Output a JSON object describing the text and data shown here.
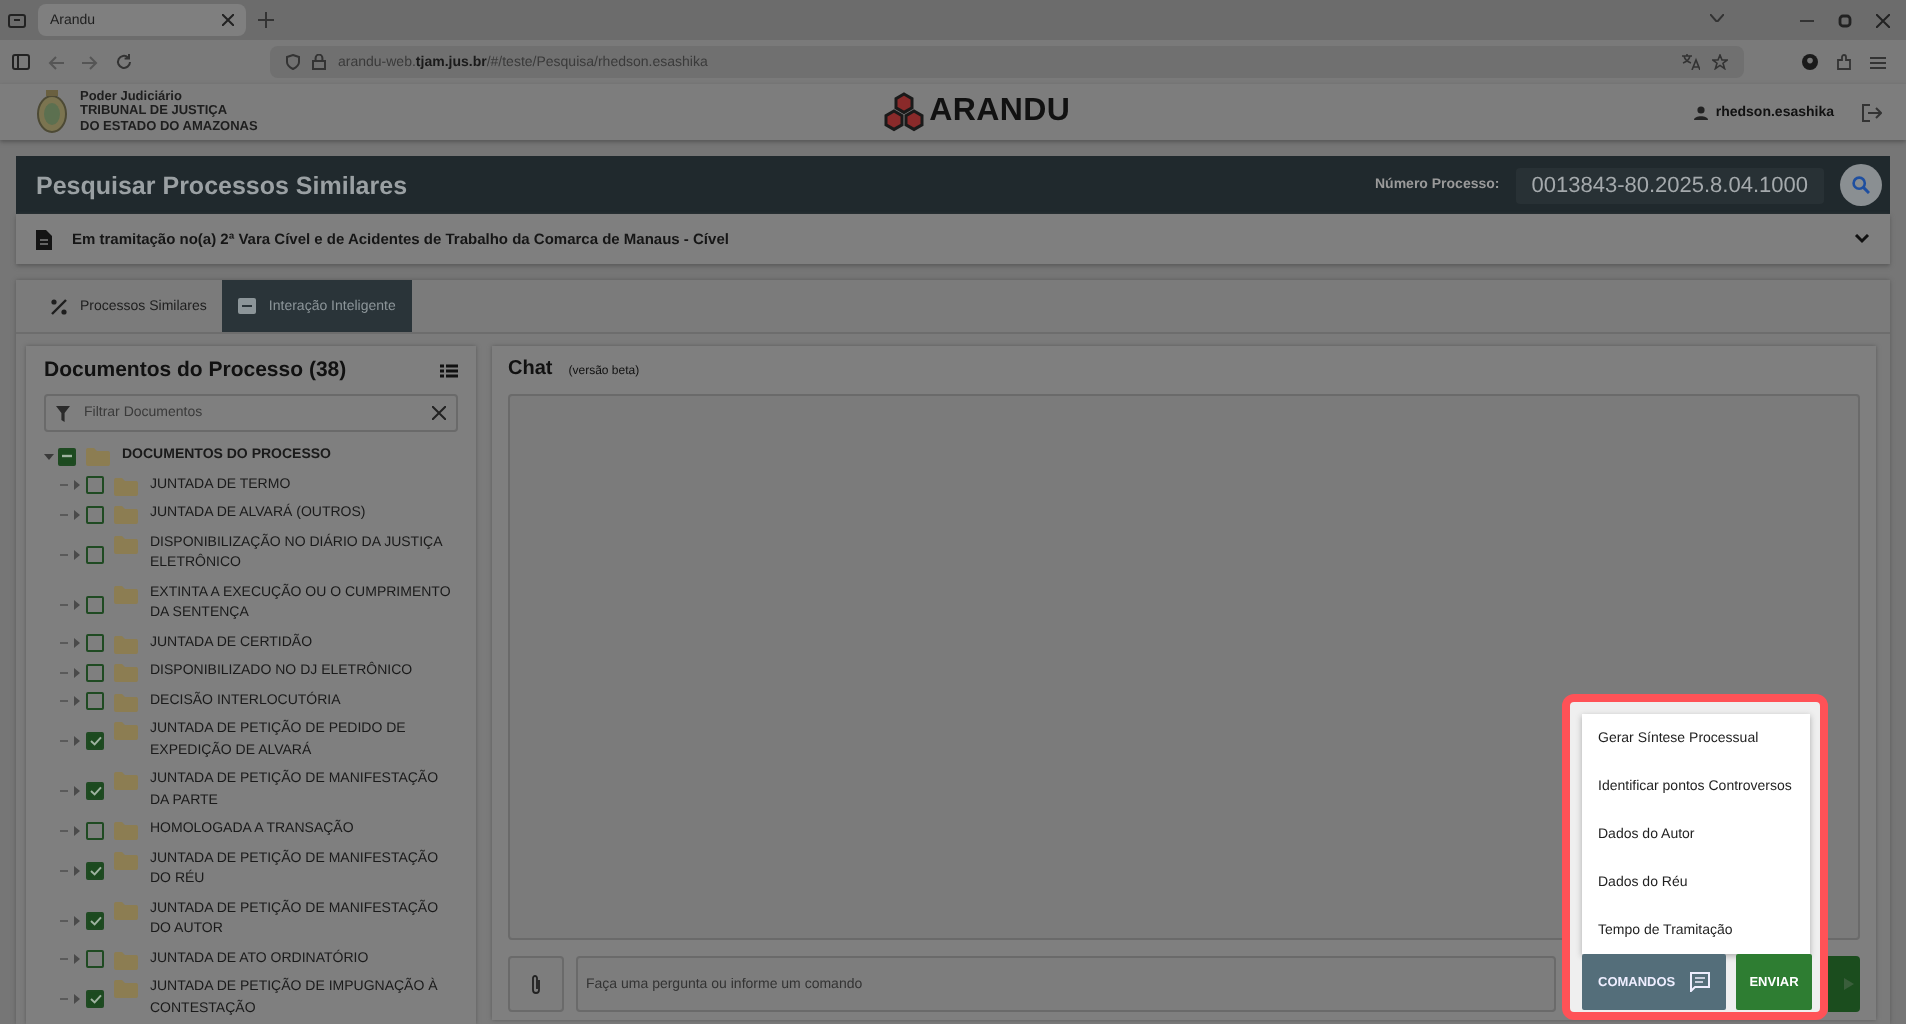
{
  "browser": {
    "tab_title": "Arandu",
    "url": "arandu-web.**tjam.jus.br**/#/teste/Pesquisa/rhedson.esashika"
  },
  "header": {
    "org_lines": [
      "Poder Judiciário",
      "TRIBUNAL DE JUSTIÇA",
      "DO ESTADO DO AMAZONAS"
    ],
    "app_name": "ARANDU",
    "user": "rhedson.esashika"
  },
  "search": {
    "title": "Pesquisar Processos Similares",
    "label": "Número Processo:",
    "value": "0013843-80.2025.8.04.1000"
  },
  "process": {
    "status": "Em tramitação no(a) 2ª Vara Cível e de Acidentes de Trabalho da Comarca de Manaus - Cível",
    "expanded": false
  },
  "tabs": [
    {
      "label": "Processos Similares",
      "selected": false
    },
    {
      "label": "Interação Inteligente",
      "selected": true
    }
  ],
  "documents": {
    "title": "Documentos do Processo (38)",
    "filter_placeholder": "Filtrar Documentos",
    "tree": [
      {
        "label": "DOCUMENTOS DO PROCESSO",
        "expanded": true,
        "checked": false,
        "indeterminate": true,
        "children": [
          {
            "label": "JUNTADA DE TERMO",
            "expanded": false,
            "checked": false
          },
          {
            "label": "JUNTADA DE ALVARÁ (OUTROS)",
            "expanded": false,
            "checked": false
          },
          {
            "label": "DISPONIBILIZAÇÃO NO DIÁRIO DA JUSTIÇA ELETRÔNICO",
            "expanded": false,
            "checked": false
          },
          {
            "label": "EXTINTA A EXECUÇÃO OU O CUMPRIMENTO DA SENTENÇA",
            "expanded": false,
            "checked": false
          },
          {
            "label": "JUNTADA DE CERTIDÃO",
            "expanded": false,
            "checked": false
          },
          {
            "label": "DISPONIBILIZADO NO DJ ELETRÔNICO",
            "expanded": false,
            "checked": false
          },
          {
            "label": "DECISÃO INTERLOCUTÓRIA",
            "expanded": false,
            "checked": false
          },
          {
            "label": "JUNTADA DE PETIÇÃO DE PEDIDO DE EXPEDIÇÃO DE ALVARÁ",
            "expanded": false,
            "checked": true
          },
          {
            "label": "JUNTADA DE PETIÇÃO DE MANIFESTAÇÃO DA PARTE",
            "expanded": false,
            "checked": true
          },
          {
            "label": "HOMOLOGADA A TRANSAÇÃO",
            "expanded": false,
            "checked": false
          },
          {
            "label": "JUNTADA DE PETIÇÃO DE MANIFESTAÇÃO DO RÉU",
            "expanded": false,
            "checked": true
          },
          {
            "label": "JUNTADA DE PETIÇÃO DE MANIFESTAÇÃO DO AUTOR",
            "expanded": false,
            "checked": true
          },
          {
            "label": "JUNTADA DE ATO ORDINATÓRIO",
            "expanded": false,
            "checked": false
          },
          {
            "label": "JUNTADA DE PETIÇÃO DE IMPUGNAÇÃO À CONTESTAÇÃO",
            "expanded": false,
            "checked": true
          }
        ]
      }
    ]
  },
  "chat": {
    "title": "Chat",
    "subtitle": "(versão beta)",
    "input_placeholder": "Faça uma pergunta ou informe um comando",
    "commands": [
      "Gerar Síntese Processual",
      "Identificar pontos Controversos",
      "Dados do Autor",
      "Dados do Réu",
      "Tempo de Tramitação"
    ],
    "commands_button": "COMANDOS",
    "send_button": "ENVIAR"
  }
}
